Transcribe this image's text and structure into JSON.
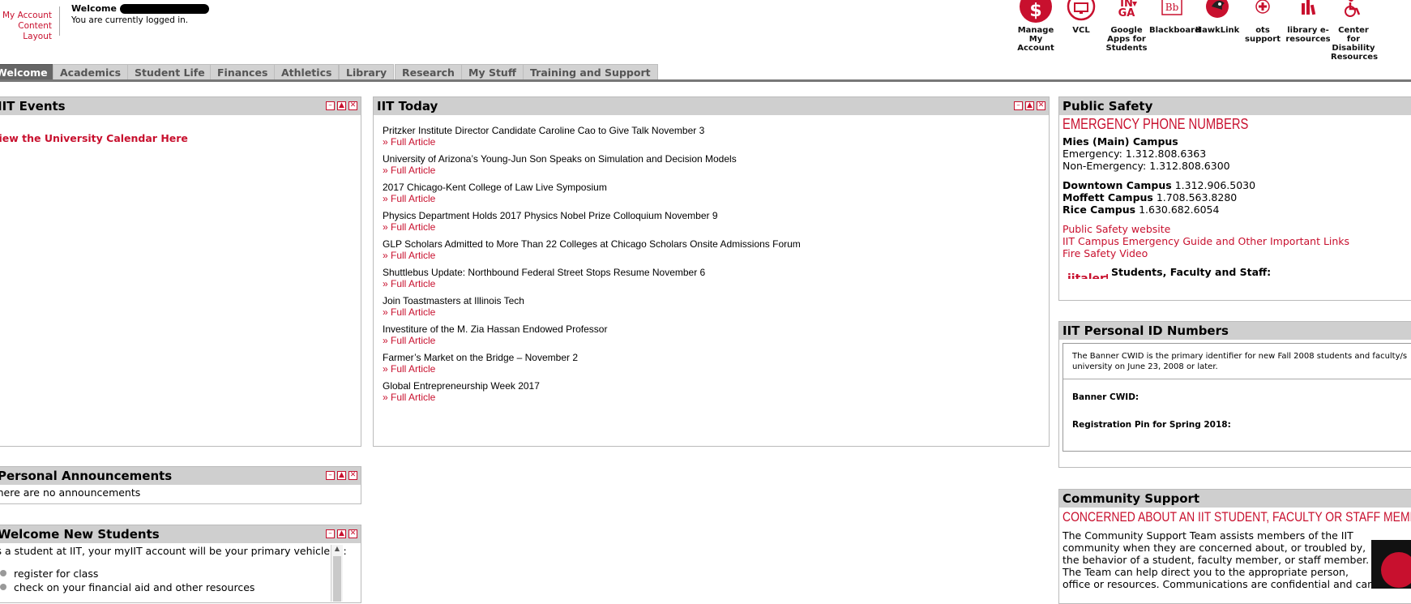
{
  "header": {
    "account_links": [
      "My Account",
      "Content Layout"
    ],
    "welcome_label": "Welcome",
    "login_status": "You are currently logged in."
  },
  "quicklinks": [
    {
      "label": "Manage My Account",
      "icon": "dollar-icon"
    },
    {
      "label": "VCL",
      "icon": "monitor-icon"
    },
    {
      "label": "Google Apps for Students",
      "icon": "google-apps-icon"
    },
    {
      "label": "Blackboard",
      "icon": "blackboard-icon"
    },
    {
      "label": "HawkLink",
      "icon": "hawk-icon"
    },
    {
      "label": "ots support",
      "icon": "red-cross-icon"
    },
    {
      "label": "library e-resources",
      "icon": "library-icon"
    },
    {
      "label": "Center for Disability Resources",
      "icon": "wheelchair-icon"
    }
  ],
  "tabs": [
    {
      "label": "Welcome",
      "active": true
    },
    {
      "label": "Academics"
    },
    {
      "label": "Student Life"
    },
    {
      "label": "Finances"
    },
    {
      "label": "Athletics"
    },
    {
      "label": "Library"
    },
    {
      "label": "Research"
    },
    {
      "label": "My Stuff"
    },
    {
      "label": "Training and Support"
    }
  ],
  "events": {
    "title": "IIT Events",
    "link": "View the University Calendar Here"
  },
  "today": {
    "title": "IIT Today",
    "more_label": "» Full Article",
    "articles": [
      "Pritzker Institute Director Candidate Caroline Cao to Give Talk November 3",
      "University of Arizona’s Young-Jun Son Speaks on Simulation and Decision Models",
      "2017 Chicago-Kent College of Law Live Symposium",
      "Physics Department Holds 2017 Physics Nobel Prize Colloquium November 9",
      "GLP Scholars Admitted to More Than 22 Colleges at Chicago Scholars Onsite Admissions Forum",
      "Shuttlebus Update: Northbound Federal Street Stops Resume November 6",
      "Join Toastmasters at Illinois Tech",
      "Investiture of the M. Zia Hassan Endowed Professor",
      "Farmer’s Market on the Bridge – November 2",
      "Global Entrepreneurship Week 2017"
    ]
  },
  "safety": {
    "title": "Public Safety",
    "heading": "EMERGENCY PHONE NUMBERS",
    "mies_label": "Mies (Main) Campus",
    "emergency": "Emergency: 1.312.808.6363",
    "non_emergency": "Non-Emergency: 1.312.808.6300",
    "downtown_label": "Downtown Campus",
    "downtown_phone": "1.312.906.5030",
    "moffett_label": "Moffett Campus",
    "moffett_phone": "1.708.563.8280",
    "rice_label": "Rice Campus",
    "rice_phone": "1.630.682.6054",
    "links": [
      "Public Safety website",
      "IIT Campus Emergency Guide and Other Important Links",
      "Fire Safety Video"
    ],
    "alert_logo": "iitalert",
    "alert_audience": "Students, Faculty and Staff:"
  },
  "personal_id": {
    "title": "IIT Personal ID Numbers",
    "intro_line1": "The Banner CWID is the primary identifier for new Fall 2008 students and faculty/s",
    "intro_line2": "university on June 23, 2008 or later.",
    "cwid_label": "Banner CWID:",
    "pin_label": "Registration Pin for Spring 2018:"
  },
  "community": {
    "title": "Community Support",
    "heading": "CONCERNED ABOUT AN IIT STUDENT, FACULTY OR STAFF MEMBER",
    "lines": [
      "The Community Support Team assists members of the IIT",
      "community when they are concerned about, or troubled by,",
      "the behavior of a student, faculty member, or staff member.",
      "The Team can help direct you to the appropriate person,",
      "office or resources. Communications are confidential and can"
    ]
  },
  "announcements": {
    "title": "Personal Announcements",
    "text": "There are no announcements"
  },
  "new_students": {
    "title": "Welcome New Students",
    "intro": "As a student at IIT, your myIIT account will be your primary vehicle to:",
    "items": [
      "register for class",
      "check on your financial aid and other resources"
    ]
  },
  "colors": {
    "accent": "#c8102e",
    "tab_bg": "#d2d2d2",
    "title_bar": "#cfcfcf"
  }
}
